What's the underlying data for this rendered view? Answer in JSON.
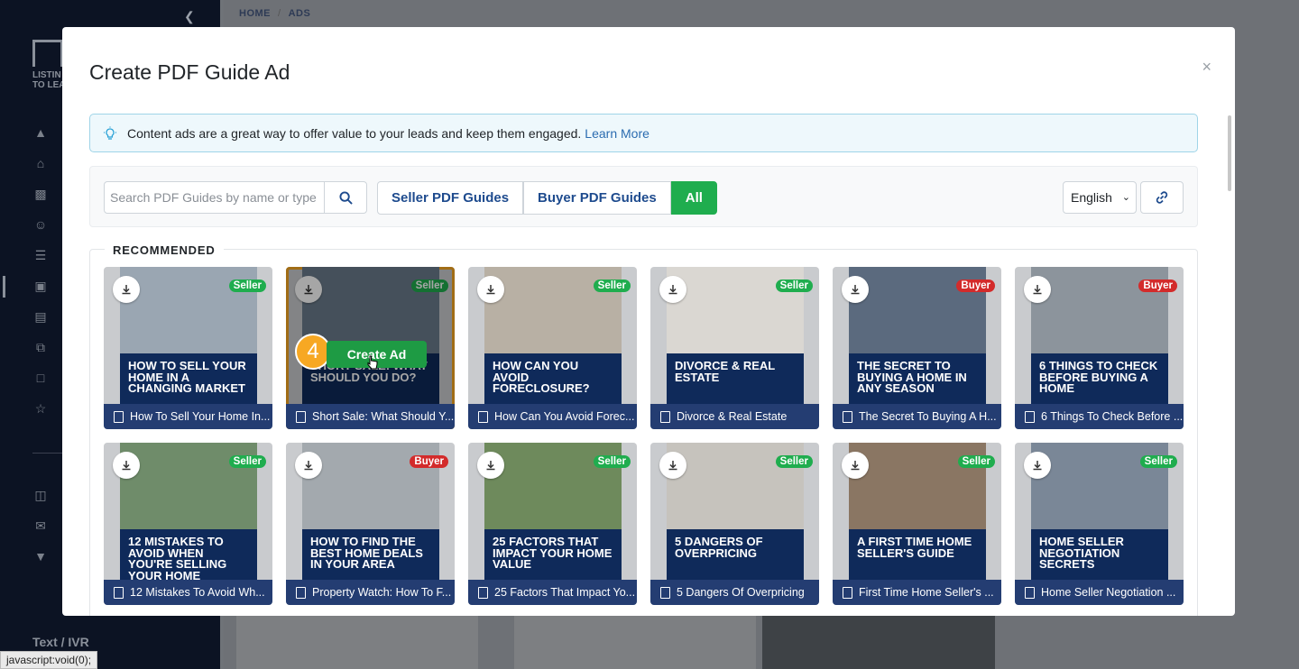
{
  "app": {
    "breadcrumb": [
      "HOME",
      "ADS"
    ],
    "logo_text": [
      "LISTIN",
      "TO LEA"
    ],
    "sidebar_bottom_label": "Text / IVR",
    "status_url": "javascript:void(0);"
  },
  "modal": {
    "title": "Create PDF Guide Ad",
    "close_symbol": "×",
    "info": {
      "text": "Content ads are a great way to offer value to your leads and keep them engaged.",
      "link": "Learn More",
      "icon": "lightbulb-icon"
    },
    "search": {
      "placeholder": "Search PDF Guides by name or type"
    },
    "filters": [
      "Seller PDF Guides",
      "Buyer PDF Guides",
      "All"
    ],
    "active_filter": "All",
    "language": "English",
    "section_label": "RECOMMENDED",
    "create_button": "Create Ad",
    "step_number": "4",
    "cards": [
      {
        "caption": "How To Sell Your Home In...",
        "headline": "How to sell your home in a changing market",
        "badge": "Seller",
        "img": "#9aa6b2"
      },
      {
        "caption": "Short Sale: What Should Y...",
        "headline": "Short sale: what should you do?",
        "badge": "Seller",
        "img": "#6b7c8c"
      },
      {
        "caption": "How Can You Avoid Forec...",
        "headline": "How can you avoid foreclosure?",
        "badge": "Seller",
        "img": "#b8b0a4"
      },
      {
        "caption": "Divorce & Real Estate",
        "headline": "Divorce & Real Estate",
        "badge": "Seller",
        "img": "#dad7d2"
      },
      {
        "caption": "The Secret To Buying A H...",
        "headline": "The secret to buying a home in any season",
        "badge": "Buyer",
        "img": "#5b6a7e"
      },
      {
        "caption": "6 Things To Check Before ...",
        "headline": "6 things to check before buying a home",
        "badge": "Buyer",
        "img": "#8c949c"
      },
      {
        "caption": "12 Mistakes To Avoid Wh...",
        "headline": "12 mistakes to avoid when you're selling your home",
        "badge": "Seller",
        "img": "#6f8c6a"
      },
      {
        "caption": "Property Watch: How To F...",
        "headline": "How to find the best home deals in your area",
        "badge": "Buyer",
        "img": "#a3a9ae"
      },
      {
        "caption": "25 Factors That Impact Yo...",
        "headline": "25 factors that impact your home value",
        "badge": "Seller",
        "img": "#6e8a5c"
      },
      {
        "caption": "5 Dangers Of Overpricing",
        "headline": "5 dangers of overpricing",
        "badge": "Seller",
        "img": "#c6c3bd"
      },
      {
        "caption": "First Time Home Seller's ...",
        "headline": "A first time home seller's guide",
        "badge": "Seller",
        "img": "#8a7663"
      },
      {
        "caption": "Home Seller Negotiation ...",
        "headline": "Home seller negotiation secrets",
        "badge": "Seller",
        "img": "#7a8797"
      }
    ]
  },
  "colors": {
    "seller_badge": "#1fad4e",
    "buyer_badge": "#d32b2b",
    "selected_outline": "#f7a823",
    "caption_bg": "#243d72",
    "active_filter_bg": "#1fad4e"
  }
}
